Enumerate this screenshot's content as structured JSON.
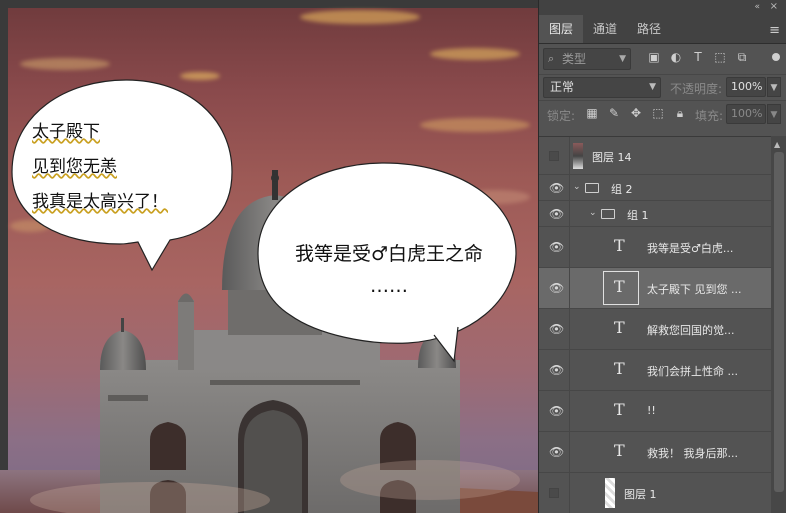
{
  "canvas": {
    "bubble1": {
      "lines": [
        "太子殿下",
        "见到您无恙",
        "我真是太高兴了！"
      ]
    },
    "bubble2": {
      "lines": [
        "我等是受♂白虎王之命",
        "……"
      ]
    }
  },
  "panel": {
    "tabs": [
      "图层",
      "通道",
      "路径"
    ],
    "filter": {
      "kind_label": "类型"
    },
    "blend_mode": "正常",
    "opacity_label": "不透明度:",
    "opacity_value": "100%",
    "lock_label": "锁定:",
    "fill_label": "填充:",
    "fill_value": "100%"
  },
  "layers": [
    {
      "name": "图层 14",
      "visible": false,
      "kind": "pixel"
    },
    {
      "name": "组 2",
      "visible": true,
      "kind": "group",
      "expanded": true
    },
    {
      "name": "组 1",
      "visible": true,
      "kind": "group",
      "expanded": true
    },
    {
      "name": "我等是受♂白虎...",
      "visible": true,
      "kind": "text"
    },
    {
      "name": "太子殿下 见到您 ...",
      "visible": true,
      "kind": "text",
      "selected": true
    },
    {
      "name": "解救您回国的觉...",
      "visible": true,
      "kind": "text"
    },
    {
      "name": "我们会拼上性命 ...",
      "visible": true,
      "kind": "text"
    },
    {
      "name": "!!",
      "visible": true,
      "kind": "text"
    },
    {
      "name": "救我！ 我身后那...",
      "visible": true,
      "kind": "text"
    },
    {
      "name": "图层 1",
      "visible": false,
      "kind": "pixel"
    }
  ],
  "colors": {
    "panel_bg": "#535353",
    "selected_row": "#6a6a6a",
    "sky": "#9d5a56"
  },
  "icons": [
    "search-icon",
    "image-filter-icon",
    "adjustment-filter-icon",
    "text-filter-icon",
    "shape-filter-icon",
    "smart-object-filter-icon",
    "lock-pixels-icon",
    "lock-paint-icon",
    "lock-move-icon",
    "lock-artboard-icon",
    "lock-all-icon",
    "eye-icon",
    "folder-icon",
    "panel-menu-icon"
  ]
}
